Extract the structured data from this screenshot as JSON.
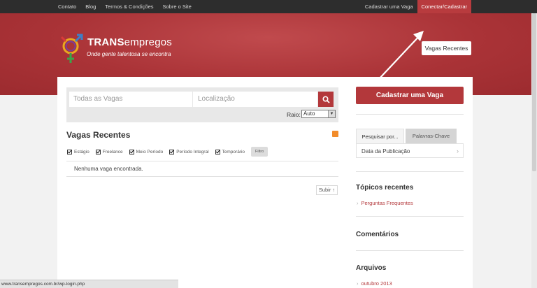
{
  "topbar": {
    "left_links": [
      "Contato",
      "Blog",
      "Termos & Condições",
      "Sobre o Site"
    ],
    "post_job": "Cadastrar uma Vaga",
    "login": "Conectar/Cadastrar"
  },
  "header": {
    "logo_bold": "TRANS",
    "logo_light": "empregos",
    "tagline": "Onde gente talentosa se encontra",
    "recent_button": "Vagas Recentes"
  },
  "search": {
    "what_placeholder": "Todas as Vagas",
    "where_placeholder": "Localização",
    "radius_label": "Raio:",
    "radius_value": "Auto"
  },
  "jobs": {
    "title": "Vagas Recentes",
    "filters": [
      "Estágio",
      "Freelance",
      "Meio Período",
      "Período Integral",
      "Temporário"
    ],
    "filter_button": "Filtro",
    "empty_message": "Nenhuma vaga encontrada.",
    "up_button": "Subir ↑"
  },
  "sidebar": {
    "cta": "Cadastrar uma Vaga",
    "tab_search": "Pesquisar por...",
    "tab_keywords": "Palavras-Chave",
    "tab_item": "Data da Publicação",
    "topics_title": "Tópicos recentes",
    "topic_link": "Perguntas Frequentes",
    "comments_title": "Comentários",
    "archives_title": "Arquivos",
    "archive_link": "outubro 2013"
  },
  "status_url": "www.transempregos.com.br/wp-login.php",
  "colors": {
    "brand_red": "#b3383b",
    "topbar": "#2d2d2d"
  }
}
